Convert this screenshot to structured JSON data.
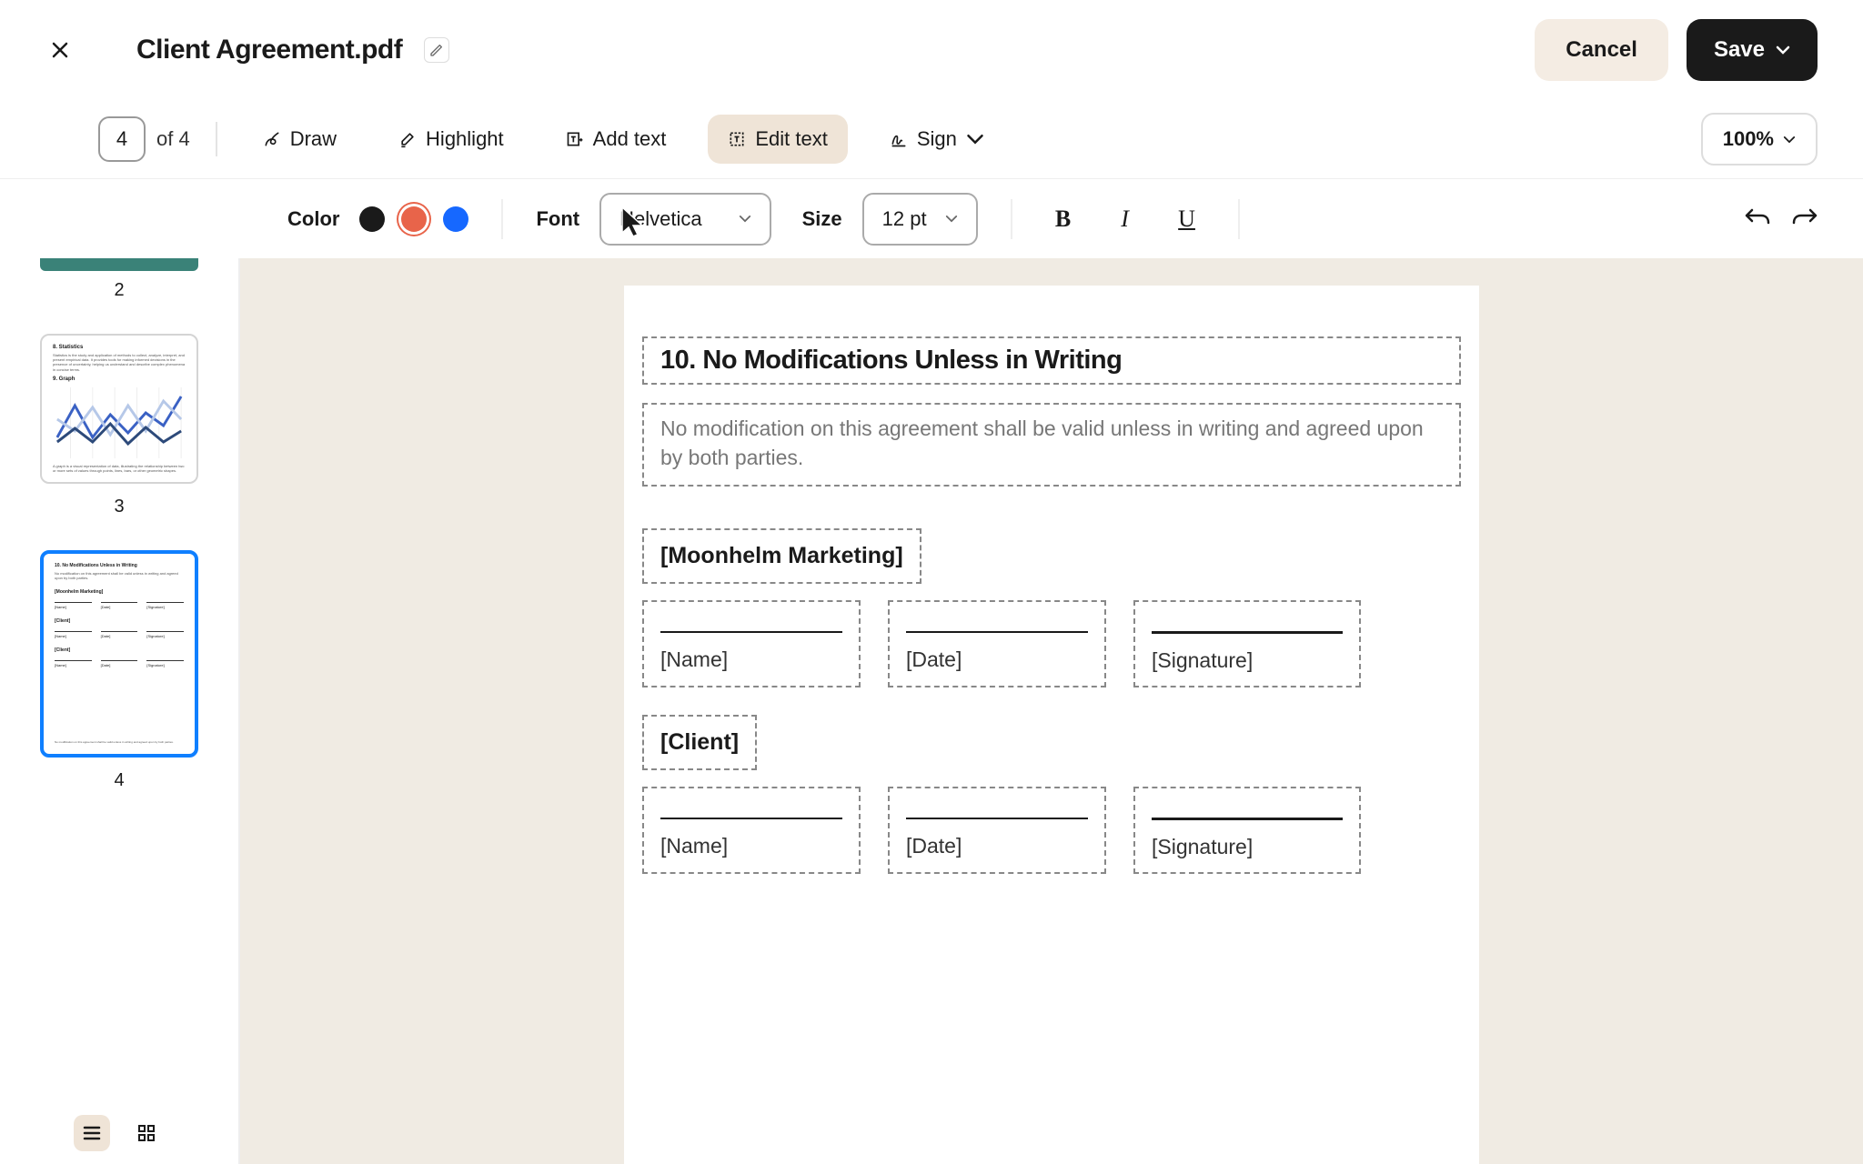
{
  "header": {
    "title": "Client Agreement.pdf",
    "cancel": "Cancel",
    "save": "Save"
  },
  "toolbar": {
    "page_current": "4",
    "page_total": "of 4",
    "draw": "Draw",
    "highlight": "Highlight",
    "add_text": "Add text",
    "edit_text": "Edit text",
    "sign": "Sign",
    "zoom": "100%"
  },
  "format": {
    "color_label": "Color",
    "colors": {
      "black": "#1a1a1a",
      "red": "#e8644a",
      "blue": "#1668ff"
    },
    "selected_color": "red",
    "font_label": "Font",
    "font_value": "Helvetica",
    "size_label": "Size",
    "size_value": "12 pt",
    "bold": "B",
    "italic": "I",
    "underline": "U"
  },
  "thumbs": {
    "n2": "2",
    "n3": "3",
    "n4": "4",
    "p3": {
      "h1": "8. Statistics",
      "body1": "Statistics is the study and application of methods to collect, analyze, interpret, and present empirical data. It provides tools for making informed decisions in the presence of uncertainty, helping us understand and describe complex phenomena in concise terms.",
      "h2": "9. Graph",
      "foot": "A graph is a visual representation of data, illustrating the relationship between two or more sets of values through points, lines, bars, or other geometric shapes."
    },
    "p4": {
      "h": "10. No Modifications Unless in Writing",
      "body": "No modification on this agreement shall be valid unless in writing and agreed upon by both parties.",
      "party1": "[Moonhelm Marketing]",
      "party2": "[Client]",
      "name": "[Name]",
      "date": "[Date]",
      "sig": "[Signature]",
      "foot": "No modification on this agreement shall be valid unless in writing and agreed upon by both parties."
    }
  },
  "doc": {
    "heading": "10. No Modifications Unless in Writing",
    "body": "No modification on this agreement shall be valid unless in writing and agreed upon by both parties.",
    "party1": "[Moonhelm Marketing]",
    "party2": "[Client]",
    "name": "[Name]",
    "date": "[Date]",
    "sig": "[Signature]"
  }
}
